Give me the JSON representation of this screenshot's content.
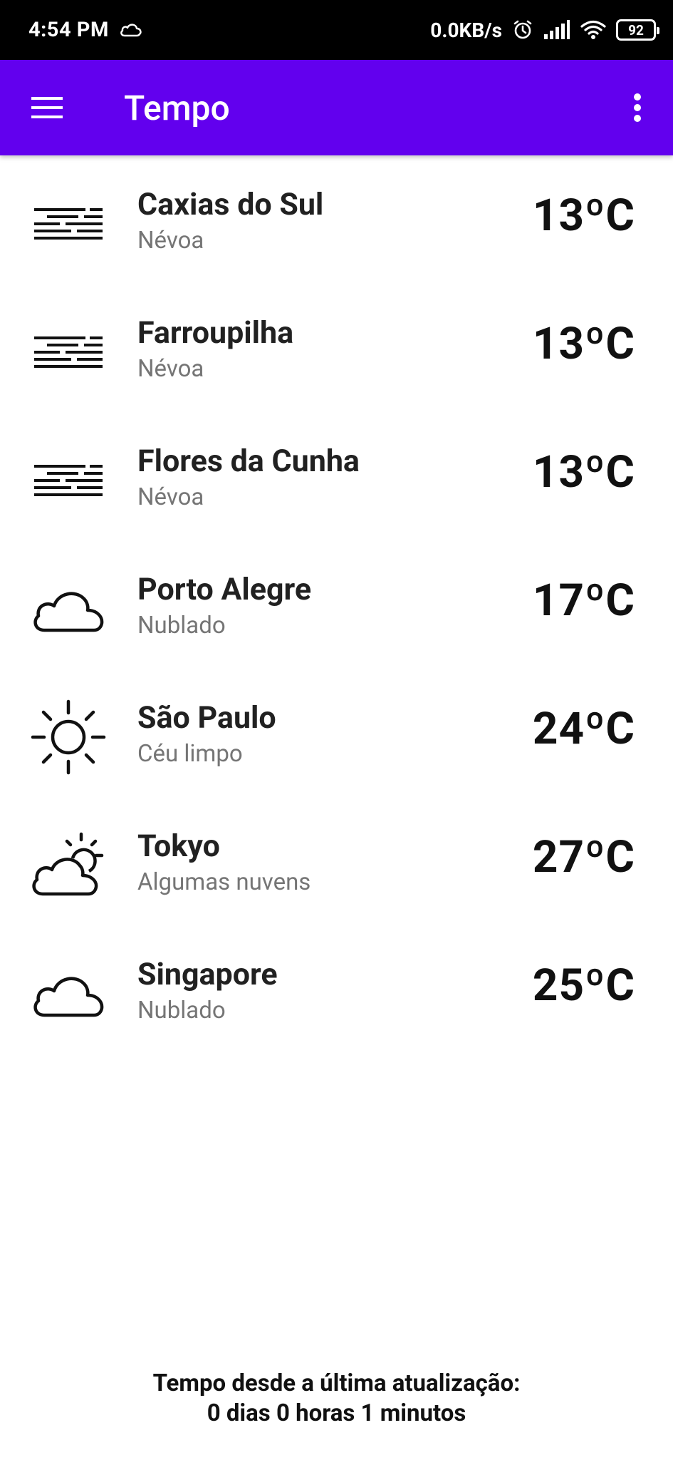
{
  "status_bar": {
    "time": "4:54 PM",
    "network_speed": "0.0KB/s",
    "battery": "92"
  },
  "app_bar": {
    "title": "Tempo",
    "menu_icon": "hamburger-menu-icon",
    "more_icon": "more-vert-icon",
    "color": "#6200ee"
  },
  "cities": [
    {
      "name": "Caxias do Sul",
      "description": "Névoa",
      "temperature": "13ºC",
      "icon": "fog-icon"
    },
    {
      "name": "Farroupilha",
      "description": "Névoa",
      "temperature": "13ºC",
      "icon": "fog-icon"
    },
    {
      "name": "Flores da Cunha",
      "description": "Névoa",
      "temperature": "13ºC",
      "icon": "fog-icon"
    },
    {
      "name": "Porto Alegre",
      "description": "Nublado",
      "temperature": "17ºC",
      "icon": "cloud-icon"
    },
    {
      "name": "São Paulo",
      "description": "Céu limpo",
      "temperature": "24ºC",
      "icon": "sun-icon"
    },
    {
      "name": "Tokyo",
      "description": "Algumas nuvens",
      "temperature": "27ºC",
      "icon": "partly-cloudy-icon"
    },
    {
      "name": "Singapore",
      "description": "Nublado",
      "temperature": "25ºC",
      "icon": "cloud-icon"
    }
  ],
  "footer": {
    "line1": "Tempo desde a última atualização:",
    "line2": "0 dias 0 horas 1 minutos"
  }
}
